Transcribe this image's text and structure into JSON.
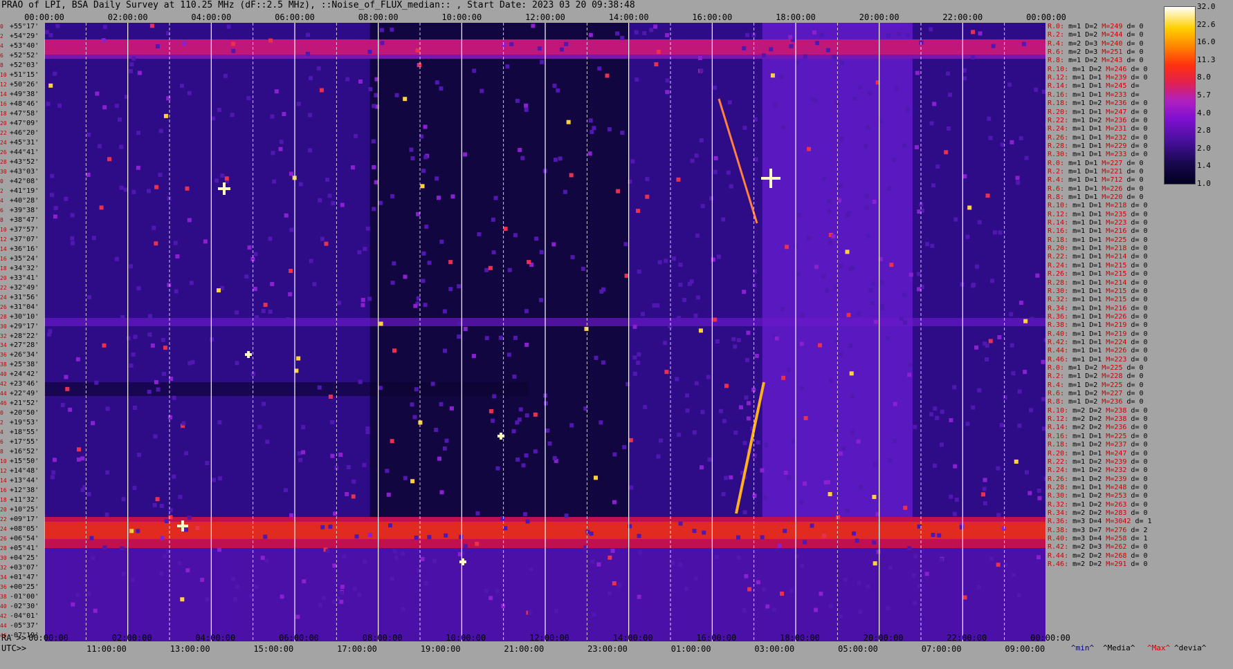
{
  "title": "PRAO of LPI, BSA Daily Survey at 110.25 MHz (dF::2.5 MHz), ::Noise_of_FLUX_median:: , Start Date: 2023 03 20 09:38:48",
  "top_ticks": [
    "00:00:00",
    "02:00:00",
    "04:00:00",
    "06:00:00",
    "08:00:00",
    "10:00:00",
    "12:00:00",
    "14:00:00",
    "16:00:00",
    "18:00:00",
    "20:00:00",
    "22:00:00",
    "00:00:00"
  ],
  "bottom_axis": {
    "ra_prefix": "RA >>",
    "ra_ticks": [
      "00:00:00",
      "02:00:00",
      "04:00:00",
      "06:00:00",
      "08:00:00",
      "10:00:00",
      "12:00:00",
      "14:00:00",
      "16:00:00",
      "18:00:00",
      "20:00:00",
      "22:00:00",
      "00:00:00"
    ],
    "utc_prefix": "UTC>>",
    "utc_ticks": [
      "11:00:00",
      "13:00:00",
      "15:00:00",
      "17:00:00",
      "19:00:00",
      "21:00:00",
      "23:00:00",
      "01:00:00",
      "03:00:00",
      "05:00:00",
      "07:00:00",
      "09:00:00"
    ]
  },
  "legend": {
    "min": "^min^",
    "media": "^Media^",
    "max": "^Max^",
    "devia": "^devia^"
  },
  "chart_data": {
    "type": "heatmap",
    "title": "PRAO of LPI, BSA Daily Survey at 110.25 MHz (dF::2.5 MHz), ::Noise_of_FLUX_median:: , Start Date: 2023 03 20 09:38:48",
    "x_axis_ra": "00:00:00 → 00:00:00 (24h)",
    "colorbar_ticks": [
      "32.0",
      "22.6",
      "16.0",
      "11.3",
      "8.0",
      "5.7",
      "4.0",
      "2.8",
      "2.0",
      "1.4",
      "1.0"
    ],
    "colorbar_scale": "log",
    "declinations": [
      "+55°17'",
      "+54°29'",
      "+53°40'",
      "+52°52'",
      "+52°03'",
      "+51°15'",
      "+50°26'",
      "+49°38'",
      "+48°46'",
      "+47°58'",
      "+47°09'",
      "+46°20'",
      "+45°31'",
      "+44°41'",
      "+43°52'",
      "+43°03'",
      "+42°08'",
      "+41°19'",
      "+40°28'",
      "+39°38'",
      "+38°47'",
      "+37°57'",
      "+37°07'",
      "+36°16'",
      "+35°24'",
      "+34°32'",
      "+33°41'",
      "+32°49'",
      "+31°56'",
      "+31°04'",
      "+30°10'",
      "+29°17'",
      "+28°22'",
      "+27°28'",
      "+26°34'",
      "+25°38'",
      "+24°42'",
      "+23°46'",
      "+22°49'",
      "+21°52'",
      "+20°50'",
      "+19°53'",
      "+18°55'",
      "+17°55'",
      "+16°52'",
      "+15°50'",
      "+14°48'",
      "+13°44'",
      "+12°38'",
      "+11°32'",
      "+10°25'",
      "+09°17'",
      "+08°05'",
      "+06°54'",
      "+05°41'",
      "+04°25'",
      "+03°07'",
      "+01°47'",
      "+00°25'",
      "-01°00'",
      "-02°30'",
      "-04°01'",
      "-05°37'",
      "-07°19'"
    ],
    "dec_indices": [
      "0",
      "2",
      "4",
      "6",
      "8",
      "10",
      "12",
      "14",
      "16",
      "18",
      "20",
      "22",
      "24",
      "26",
      "28",
      "30",
      "0",
      "2",
      "4",
      "6",
      "8",
      "10",
      "12",
      "14",
      "16",
      "18",
      "20",
      "22",
      "24",
      "26",
      "28",
      "30",
      "32",
      "34",
      "36",
      "38",
      "40",
      "42",
      "44",
      "46",
      "0",
      "2",
      "4",
      "6",
      "8",
      "10",
      "12",
      "14",
      "16",
      "18",
      "20",
      "22",
      "24",
      "26",
      "28",
      "30",
      "32",
      "34",
      "36",
      "38",
      "40",
      "42",
      "44",
      "46"
    ],
    "row_stats": [
      [
        "R.0:",
        "m=1",
        "D=2",
        "M=249",
        "d= 0"
      ],
      [
        "R.2:",
        "m=1",
        "D=2",
        "M=244",
        "d= 0"
      ],
      [
        "R.4:",
        "m=2",
        "D=3",
        "M=240",
        "d= 0"
      ],
      [
        "R.6:",
        "m=2",
        "D=3",
        "M=251",
        "d= 0"
      ],
      [
        "R.8:",
        "m=1",
        "D=2",
        "M=243",
        "d= 0"
      ],
      [
        "R.10:",
        "m=1",
        "D=2",
        "M=246",
        "d= 0"
      ],
      [
        "R.12:",
        "m=1",
        "D=1",
        "M=239",
        "d= 0"
      ],
      [
        "R.14:",
        "m=1",
        "D=1",
        "M=245",
        "d="
      ],
      [
        "R.16:",
        "m=1",
        "D=1",
        "M=233",
        "d="
      ],
      [
        "R.18:",
        "m=1",
        "D=2",
        "M=236",
        "d= 0"
      ],
      [
        "R.20:",
        "m=1",
        "D=1",
        "M=247",
        "d= 0"
      ],
      [
        "R.22:",
        "m=1",
        "D=2",
        "M=236",
        "d= 0"
      ],
      [
        "R.24:",
        "m=1",
        "D=1",
        "M=231",
        "d= 0"
      ],
      [
        "R.26:",
        "m=1",
        "D=1",
        "M=232",
        "d= 0"
      ],
      [
        "R.28:",
        "m=1",
        "D=1",
        "M=229",
        "d= 0"
      ],
      [
        "R.30:",
        "m=1",
        "D=1",
        "M=233",
        "d= 0"
      ],
      [
        "R.0:",
        "m=1",
        "D=1",
        "M=227",
        "d= 0"
      ],
      [
        "R.2:",
        "m=1",
        "D=1",
        "M=221",
        "d= 0"
      ],
      [
        "R.4:",
        "m=1",
        "D=1",
        "M=712",
        "d= 0"
      ],
      [
        "R.6:",
        "m=1",
        "D=1",
        "M=226",
        "d= 0"
      ],
      [
        "R.8:",
        "m=1",
        "D=1",
        "M=220",
        "d= 0"
      ],
      [
        "R.10:",
        "m=1",
        "D=1",
        "M=218",
        "d= 0"
      ],
      [
        "R.12:",
        "m=1",
        "D=1",
        "M=235",
        "d= 0"
      ],
      [
        "R.14:",
        "m=1",
        "D=1",
        "M=223",
        "d= 0"
      ],
      [
        "R.16:",
        "m=1",
        "D=1",
        "M=216",
        "d= 0"
      ],
      [
        "R.18:",
        "m=1",
        "D=1",
        "M=225",
        "d= 0"
      ],
      [
        "R.20:",
        "m=1",
        "D=1",
        "M=218",
        "d= 0"
      ],
      [
        "R.22:",
        "m=1",
        "D=1",
        "M=214",
        "d= 0"
      ],
      [
        "R.24:",
        "m=1",
        "D=1",
        "M=215",
        "d= 0"
      ],
      [
        "R.26:",
        "m=1",
        "D=1",
        "M=215",
        "d= 0"
      ],
      [
        "R.28:",
        "m=1",
        "D=1",
        "M=214",
        "d= 0"
      ],
      [
        "R.30:",
        "m=1",
        "D=1",
        "M=215",
        "d= 0"
      ],
      [
        "R.32:",
        "m=1",
        "D=1",
        "M=215",
        "d= 0"
      ],
      [
        "R.34:",
        "m=1",
        "D=1",
        "M=216",
        "d= 0"
      ],
      [
        "R.36:",
        "m=1",
        "D=1",
        "M=226",
        "d= 0"
      ],
      [
        "R.38:",
        "m=1",
        "D=1",
        "M=219",
        "d= 0"
      ],
      [
        "R.40:",
        "m=1",
        "D=1",
        "M=219",
        "d= 0"
      ],
      [
        "R.42:",
        "m=1",
        "D=1",
        "M=224",
        "d= 0"
      ],
      [
        "R.44:",
        "m=1",
        "D=1",
        "M=226",
        "d= 0"
      ],
      [
        "R.46:",
        "m=1",
        "D=1",
        "M=223",
        "d= 0"
      ],
      [
        "R.0:",
        "m=1",
        "D=2",
        "M=225",
        "d= 0"
      ],
      [
        "R.2:",
        "m=1",
        "D=2",
        "M=228",
        "d= 0"
      ],
      [
        "R.4:",
        "m=1",
        "D=2",
        "M=225",
        "d= 0"
      ],
      [
        "R.6:",
        "m=1",
        "D=2",
        "M=227",
        "d= 0"
      ],
      [
        "R.8:",
        "m=1",
        "D=2",
        "M=236",
        "d= 0"
      ],
      [
        "R.10:",
        "m=2",
        "D=2",
        "M=238",
        "d= 0"
      ],
      [
        "R.12:",
        "m=2",
        "D=2",
        "M=238",
        "d= 0"
      ],
      [
        "R.14:",
        "m=2",
        "D=2",
        "M=236",
        "d= 0"
      ],
      [
        "R.16:",
        "m=1",
        "D=1",
        "M=225",
        "d= 0"
      ],
      [
        "R.18:",
        "m=1",
        "D=2",
        "M=237",
        "d= 0"
      ],
      [
        "R.20:",
        "m=1",
        "D=1",
        "M=247",
        "d= 0"
      ],
      [
        "R.22:",
        "m=1",
        "D=2",
        "M=239",
        "d= 0"
      ],
      [
        "R.24:",
        "m=1",
        "D=2",
        "M=232",
        "d= 0"
      ],
      [
        "R.26:",
        "m=1",
        "D=2",
        "M=239",
        "d= 0"
      ],
      [
        "R.28:",
        "m=1",
        "D=1",
        "M=248",
        "d= 0"
      ],
      [
        "R.30:",
        "m=1",
        "D=2",
        "M=253",
        "d= 0"
      ],
      [
        "R.32:",
        "m=1",
        "D=2",
        "M=263",
        "d= 0"
      ],
      [
        "R.34:",
        "m=2",
        "D=2",
        "M=283",
        "d= 0"
      ],
      [
        "R.36:",
        "m=3",
        "D=4",
        "M=3042",
        "d= 1"
      ],
      [
        "R.38:",
        "m=3",
        "D=7",
        "M=276",
        "d= 2"
      ],
      [
        "R.40:",
        "m=3",
        "D=4",
        "M=258",
        "d= 1"
      ],
      [
        "R.42:",
        "m=2",
        "D=3",
        "M=262",
        "d= 0"
      ],
      [
        "R.44:",
        "m=2",
        "D=2",
        "M=268",
        "d= 0"
      ],
      [
        "R.46:",
        "m=2",
        "D=2",
        "M=291",
        "d= 0"
      ]
    ]
  }
}
